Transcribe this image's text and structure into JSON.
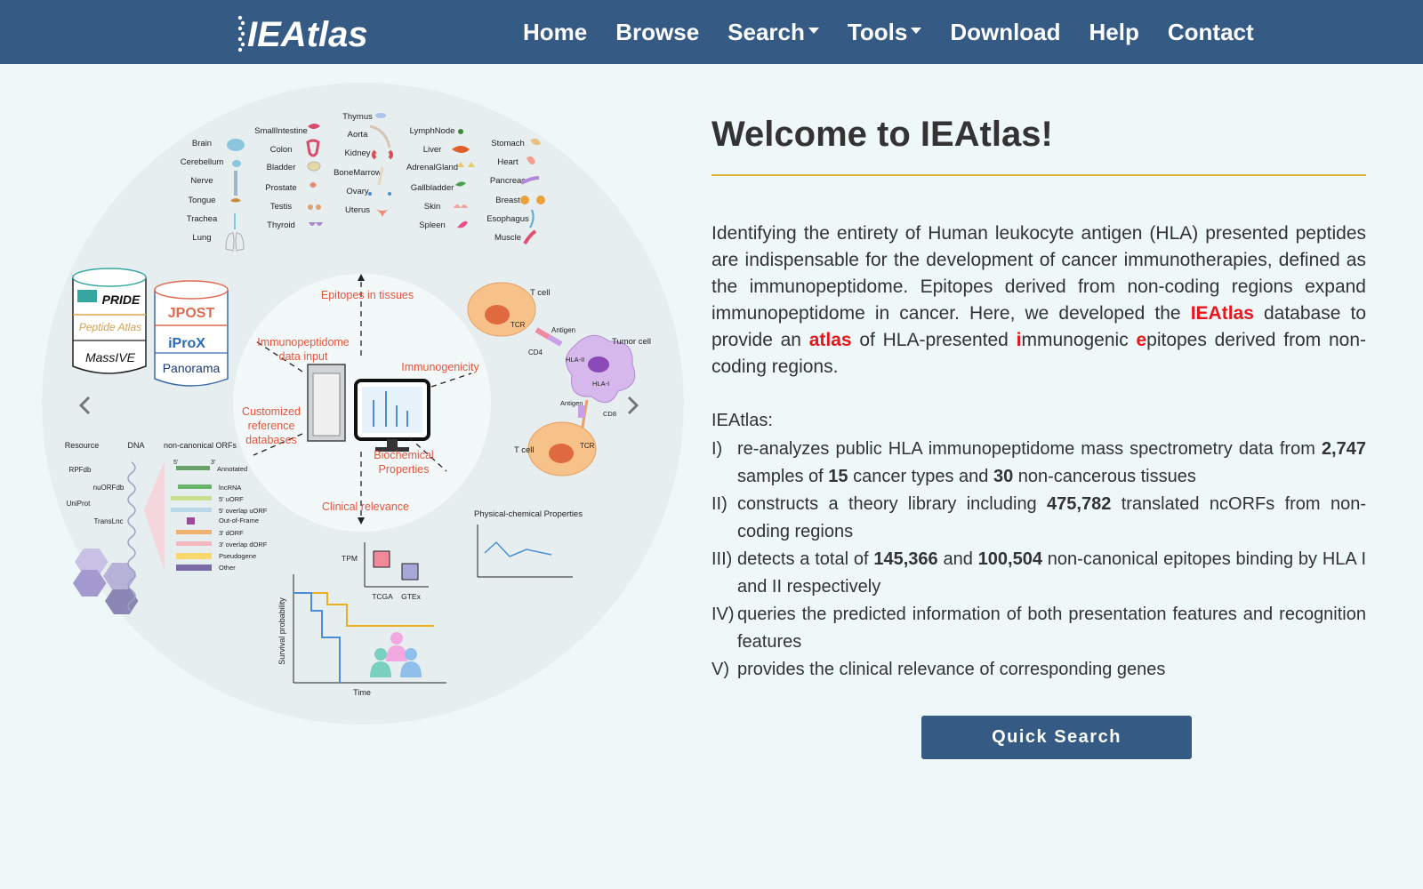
{
  "brand": {
    "logo_text": "IEAtlas"
  },
  "nav": {
    "home": "Home",
    "browse": "Browse",
    "search": "Search",
    "tools": "Tools",
    "download": "Download",
    "help": "Help",
    "contact": "Contact"
  },
  "figure": {
    "tissues_left": [
      "Brain",
      "Cerebellum",
      "Nerve",
      "Tongue",
      "Trachea",
      "Lung"
    ],
    "tissues_mid": [
      "SmallIntestine",
      "Colon",
      "Bladder",
      "Prostate",
      "Testis",
      "Thyroid"
    ],
    "tissues_center": [
      "Thymus",
      "Aorta",
      "Kidney",
      "BoneMarrow",
      "Ovary",
      "Uterus"
    ],
    "tissues_right1": [
      "LymphNode",
      "Liver",
      "AdrenalGland",
      "Gallbladder",
      "Skin",
      "Spleen"
    ],
    "tissues_right2": [
      "Stomach",
      "Heart",
      "Pancreas",
      "Breast",
      "Esophagus",
      "Muscle"
    ],
    "db_left": [
      "PRIDE",
      "Peptide Atlas",
      "MassIVE"
    ],
    "db_right": [
      "JPOST",
      "iProX",
      "Panorama"
    ],
    "labels": {
      "epitopes_tissues": "Epitopes in tissues",
      "immunopeptidome_1": "Immunopeptidome",
      "immunopeptidome_2": "data input",
      "immunogenicity": "Immunogenicity",
      "customized_1": "Customized",
      "customized_2": "reference",
      "customized_3": "databases",
      "biochemical_1": "Biochemical",
      "biochemical_2": "Properties",
      "clinical": "Clinical relevance"
    },
    "cells": {
      "t_cell_top": "T cell",
      "tcr": "TCR",
      "antigen": "Antigen",
      "cd4": "CD4",
      "hla_ii": "HLA-II",
      "tumor_cell": "Tumor cell",
      "hla_i": "HLA-I",
      "antigen2": "Antigen",
      "cd8": "CD8",
      "t_cell_bottom": "T cell",
      "tcr2": "TCR"
    },
    "resource": {
      "resource": "Resource",
      "dna": "DNA",
      "orfs": "non-canonical ORFs",
      "dbs": [
        "RPFdb",
        "nuORFdb",
        "UniProt",
        "TransLnc"
      ],
      "five": "5'",
      "three": "3'",
      "orf_types": [
        "Annotated",
        "lncRNA",
        "5' uORF",
        "5' overlap uORF",
        "Out-of-Frame",
        "3' dORF",
        "3' overlap dORF",
        "Pseudogene",
        "Other"
      ]
    },
    "plots": {
      "tpm": "TPM",
      "tcga": "TCGA",
      "gtex": "GTEx",
      "physchem": "Physical-chemical Properties",
      "survival": "Survival probability",
      "time": "Time"
    }
  },
  "welcome": {
    "title": "Welcome to IEAtlas!",
    "intro_1": "Identifying the entirety of Human leukocyte antigen (HLA) presented peptides are indispensable for the development of cancer immunotherapies, defined as the immunopeptidome. Epitopes derived from non-coding regions expand immunopeptidome in cancer. Here, we developed the ",
    "intro_red_1": "IEAtlas",
    "intro_2": " database to provide an ",
    "intro_red_2": "atlas",
    "intro_3": " of HLA-presented ",
    "intro_red_3": "i",
    "intro_4": "mmunogenic ",
    "intro_red_4": "e",
    "intro_5": "pitopes derived from non-coding regions.",
    "sub": "IEAtlas:",
    "items": [
      {
        "num": "I)",
        "a": "re-analyzes public HLA immunopeptidome mass spectrometry data from ",
        "b1": "2,747",
        "c": " samples of ",
        "b2": "15",
        "d": " cancer types and ",
        "b3": "30",
        "e": " non-cancerous tissues"
      },
      {
        "num": "II)",
        "a": "constructs a theory library including ",
        "b1": "475,782",
        "c": " translated ncORFs from non-coding regions"
      },
      {
        "num": "III)",
        "a": "detects a total of ",
        "b1": "145,366",
        "c": " and ",
        "b2": "100,504",
        "d": " non-canonical epitopes binding by HLA I and II respectively"
      },
      {
        "num": "IV)",
        "a": "queries the predicted information of both presentation features and recognition features"
      },
      {
        "num": "V)",
        "a": "provides the clinical relevance of corresponding genes"
      }
    ]
  },
  "quick_search": "Quick Search",
  "colors": {
    "nav": "#355a84",
    "accent_red": "#e8161b",
    "rule": "#e0b33a",
    "bg": "#eef8f8"
  }
}
